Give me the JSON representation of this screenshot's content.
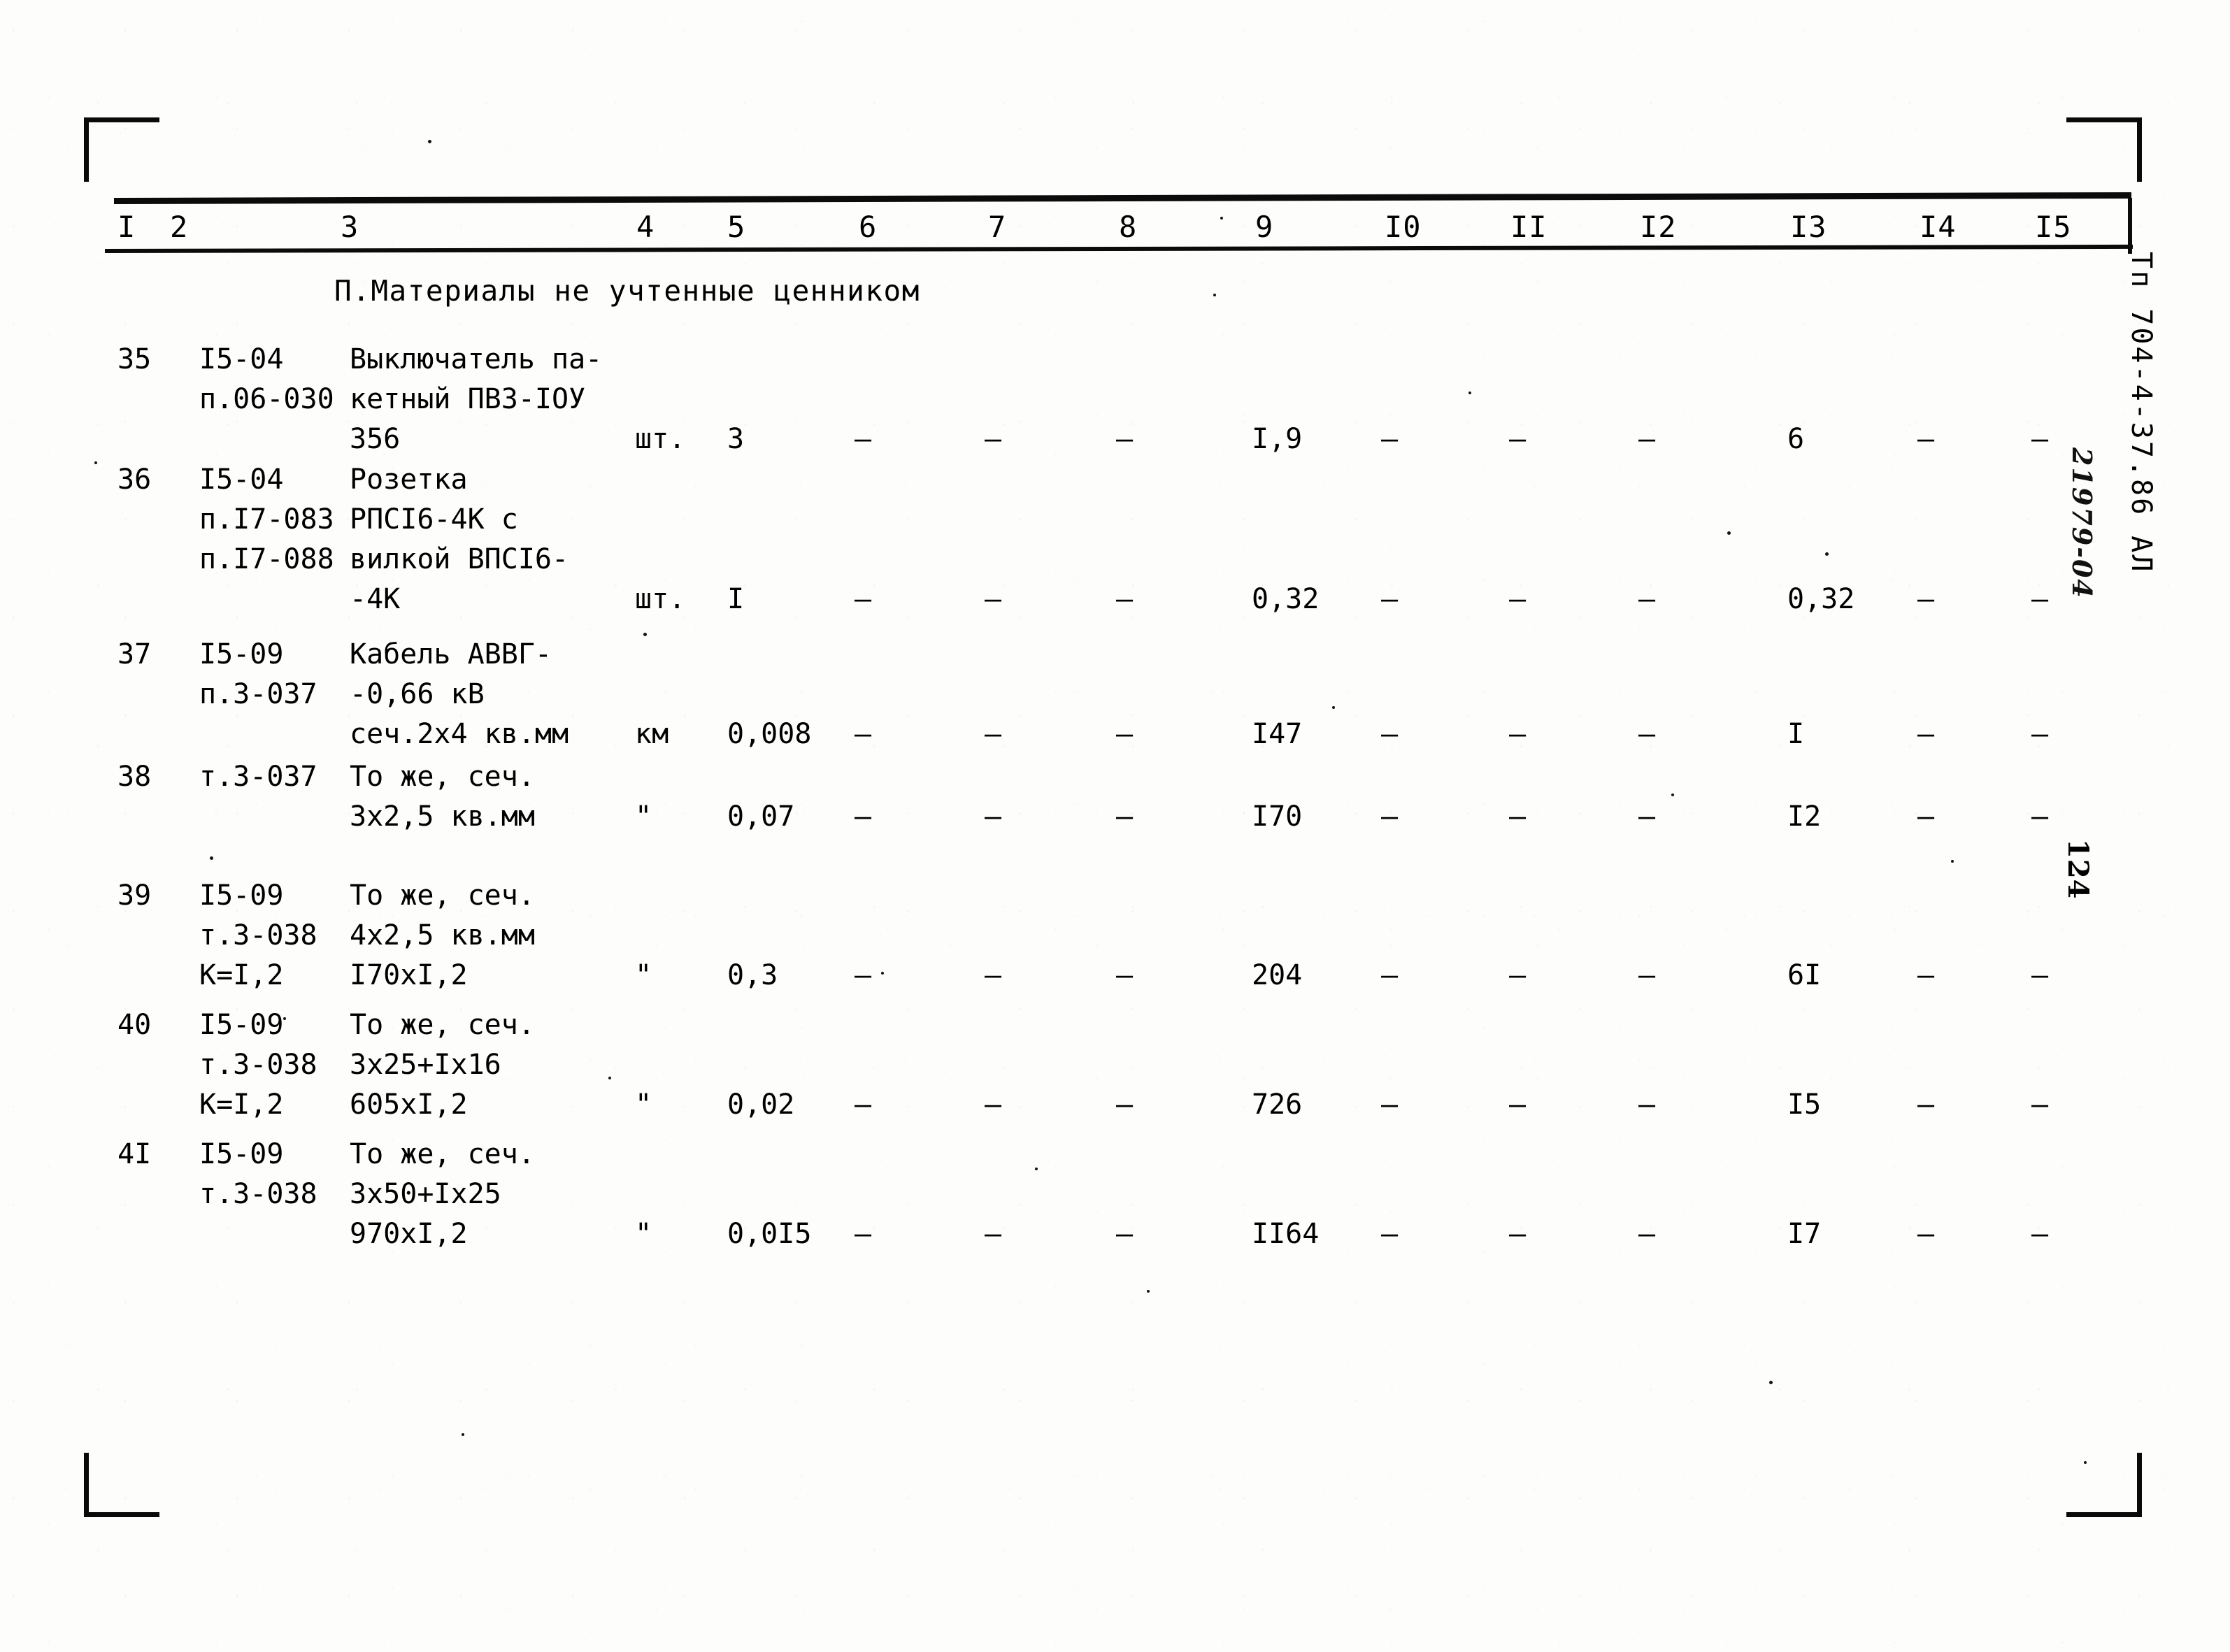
{
  "document": {
    "section_caption": "П.Материалы не учтенные ценником",
    "margin_stamp": "Тп 704-4-37.86  АЛ",
    "margin_handwritten": "21979-04",
    "margin_page_number": "124"
  },
  "table": {
    "column_headers": [
      "I",
      "2",
      "3",
      "4",
      "5",
      "6",
      "7",
      "8",
      "9",
      "I0",
      "II",
      "I2",
      "I3",
      "I4",
      "I5"
    ],
    "dash": "–",
    "ditto": "\"",
    "rows": [
      {
        "no": "35",
        "code_lines": [
          "I5-04",
          "п.06-030"
        ],
        "desc_lines": [
          "Выключатель па-",
          "кетный ПВЗ-IОУ",
          "356"
        ],
        "unit": "шт.",
        "c5": "3",
        "c6": "–",
        "c7": "–",
        "c8": "–",
        "c9": "I,9",
        "c10": "–",
        "c11": "–",
        "c12": "–",
        "c13": "6",
        "c14": "–",
        "c15": "–"
      },
      {
        "no": "36",
        "code_lines": [
          "I5-04",
          "п.I7-083",
          "п.I7-088"
        ],
        "desc_lines": [
          "Розетка",
          "РПСI6-4К с",
          "вилкой ВПСI6-",
          "-4К"
        ],
        "unit": "шт.",
        "c5": "I",
        "c6": "–",
        "c7": "–",
        "c8": "–",
        "c9": "0,32",
        "c10": "–",
        "c11": "–",
        "c12": "–",
        "c13": "0,32",
        "c14": "–",
        "c15": "–"
      },
      {
        "no": "37",
        "code_lines": [
          "I5-09",
          "п.3-037"
        ],
        "desc_lines": [
          "Кабель АВВГ-",
          "-0,66 кВ",
          "сеч.2х4 кв.мм"
        ],
        "unit": "км",
        "c5": "0,008",
        "c6": "–",
        "c7": "–",
        "c8": "–",
        "c9": "I47",
        "c10": "–",
        "c11": "–",
        "c12": "–",
        "c13": "I",
        "c14": "–",
        "c15": "–"
      },
      {
        "no": "38",
        "code_lines": [
          "т.3-037"
        ],
        "desc_lines": [
          "То же, сеч.",
          "3х2,5 кв.мм"
        ],
        "unit": "\"",
        "c5": "0,07",
        "c6": "–",
        "c7": "–",
        "c8": "–",
        "c9": "I70",
        "c10": "–",
        "c11": "–",
        "c12": "–",
        "c13": "I2",
        "c14": "–",
        "c15": "–"
      },
      {
        "no": "39",
        "code_lines": [
          "I5-09",
          "т.3-038",
          "К=I,2"
        ],
        "desc_lines": [
          "То же, сеч.",
          "4х2,5 кв.мм",
          "I70хI,2"
        ],
        "unit": "\"",
        "c5": "0,3",
        "c6": "–",
        "c7": "–",
        "c8": "–",
        "c9": "204",
        "c10": "–",
        "c11": "–",
        "c12": "–",
        "c13": "6I",
        "c14": "–",
        "c15": "–"
      },
      {
        "no": "40",
        "code_lines": [
          "I5-09",
          "т.3-038",
          "К=I,2"
        ],
        "desc_lines": [
          "То же, сеч.",
          "3х25+Iх16",
          "605хI,2"
        ],
        "unit": "\"",
        "c5": "0,02",
        "c6": "–",
        "c7": "–",
        "c8": "–",
        "c9": "726",
        "c10": "–",
        "c11": "–",
        "c12": "–",
        "c13": "I5",
        "c14": "–",
        "c15": "–"
      },
      {
        "no": "4I",
        "code_lines": [
          "I5-09",
          "т.3-038"
        ],
        "desc_lines": [
          "То же, сеч.",
          "3х50+Iх25",
          "970хI,2"
        ],
        "unit": "\"",
        "c5": "0,0I5",
        "c6": "–",
        "c7": "–",
        "c8": "–",
        "c9": "II64",
        "c10": "–",
        "c11": "–",
        "c12": "–",
        "c13": "I7",
        "c14": "–",
        "c15": "–"
      }
    ]
  }
}
